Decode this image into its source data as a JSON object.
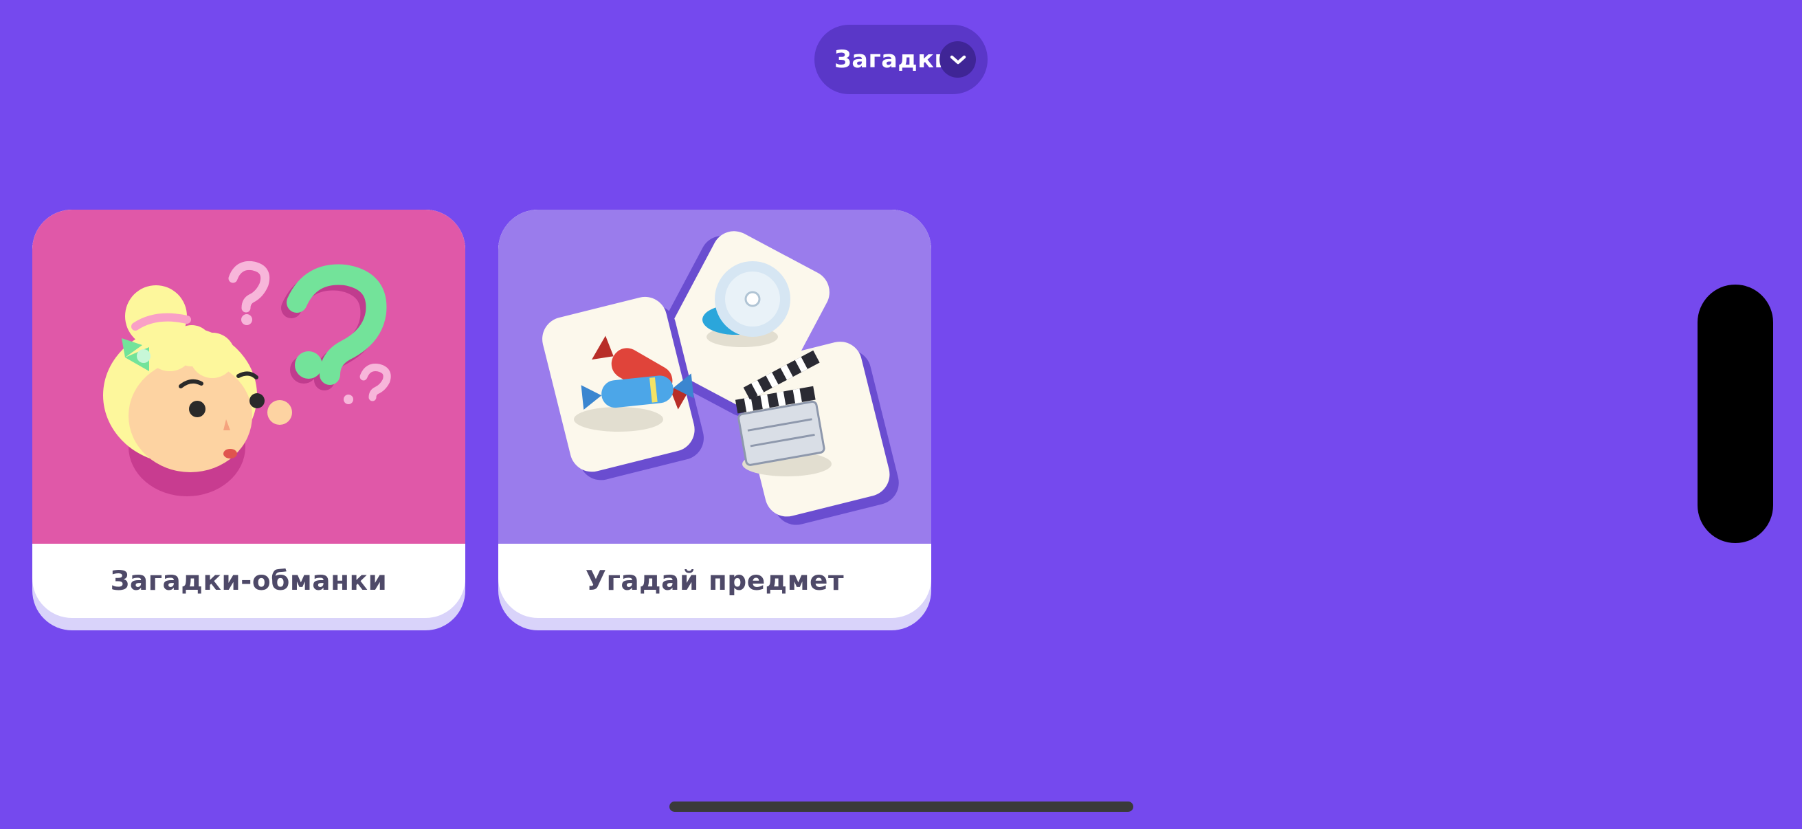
{
  "header": {
    "category_label": "Загадки",
    "dropdown_icon": "chevron-down-icon"
  },
  "cards": [
    {
      "title": "Загадки-обманки",
      "art": "thinking-girl-with-question-marks",
      "art_color": "#E058A8"
    },
    {
      "title": "Угадай предмет",
      "art": "cards-candy-disc-clapperboard",
      "art_color": "#9A7CEC"
    }
  ],
  "colors": {
    "background": "#7549EE",
    "pill": "#5A37C8",
    "caption_text": "#4E4968"
  }
}
